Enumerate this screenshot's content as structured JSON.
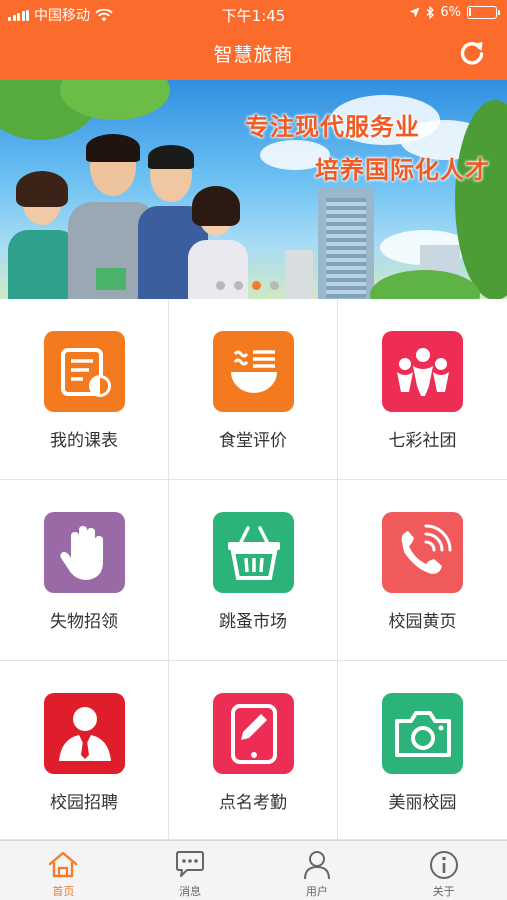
{
  "status_bar": {
    "carrier": "中国移动",
    "time": "下午1:45",
    "battery": "6%",
    "battery_level": 0.06
  },
  "header": {
    "title": "智慧旅商",
    "refresh_icon": "refresh-icon"
  },
  "banner": {
    "line1": "专注现代服务业",
    "line2": "培养国际化人才",
    "slide_count": 4,
    "active_slide": 3
  },
  "grid": {
    "items": [
      {
        "label": "我的课表",
        "icon": "schedule-icon",
        "color": "#f47a1f"
      },
      {
        "label": "食堂评价",
        "icon": "bowl-icon",
        "color": "#f47a1f"
      },
      {
        "label": "七彩社团",
        "icon": "people-icon",
        "color": "#ee2d55"
      },
      {
        "label": "失物招领",
        "icon": "hand-icon",
        "color": "#9a6aa6"
      },
      {
        "label": "跳蚤市场",
        "icon": "basket-icon",
        "color": "#2cb37a"
      },
      {
        "label": "校园黄页",
        "icon": "phone-icon",
        "color": "#f05a5a"
      },
      {
        "label": "校园招聘",
        "icon": "person-tie-icon",
        "color": "#e01d2a"
      },
      {
        "label": "点名考勤",
        "icon": "tablet-pen-icon",
        "color": "#ee2d55"
      },
      {
        "label": "美丽校园",
        "icon": "camera-icon",
        "color": "#2cb37a"
      }
    ]
  },
  "tabbar": {
    "tabs": [
      {
        "label": "首页",
        "icon": "home-icon",
        "active": true
      },
      {
        "label": "消息",
        "icon": "chat-icon",
        "active": false
      },
      {
        "label": "用户",
        "icon": "user-icon",
        "active": false
      },
      {
        "label": "关于",
        "icon": "info-icon",
        "active": false
      }
    ],
    "accent": "#f47a2c"
  },
  "colors": {
    "header_bg": "#fb6c2c"
  }
}
